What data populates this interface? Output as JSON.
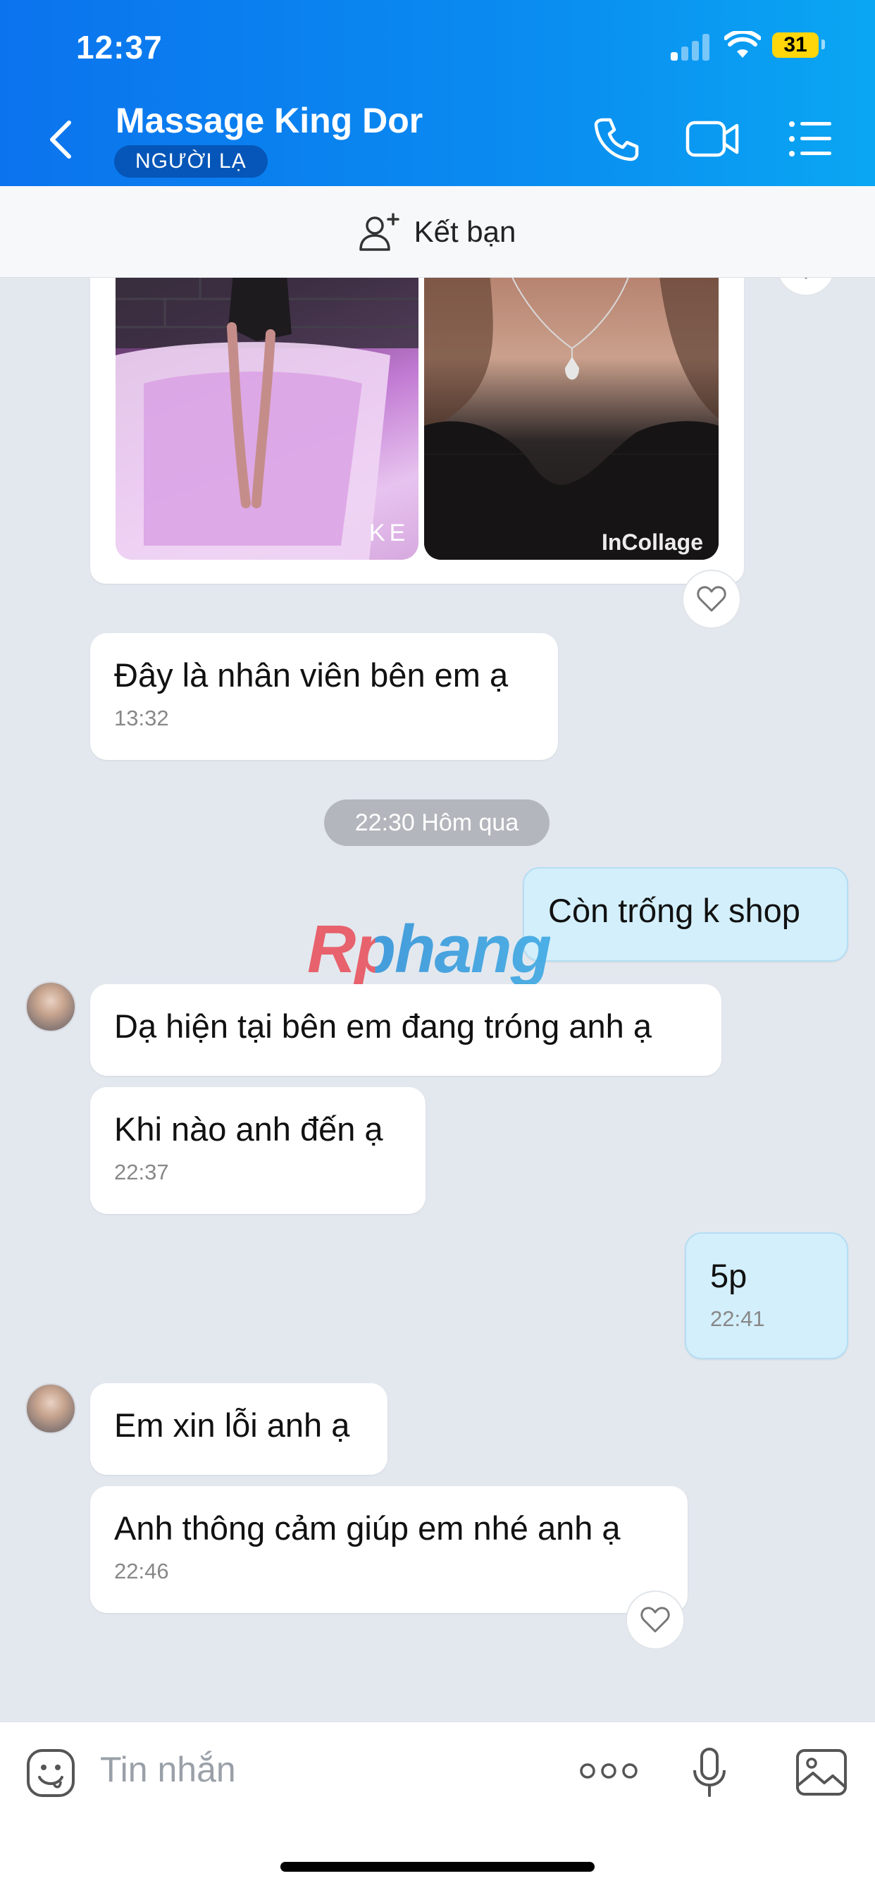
{
  "status_bar": {
    "time": "12:37",
    "battery": "31"
  },
  "header": {
    "title": "Massage King Dor",
    "badge": "NGƯỜI LẠ",
    "icons": [
      "back-icon",
      "phone-icon",
      "video-call-icon",
      "menu-list-icon"
    ]
  },
  "friend_bar": {
    "label": "Kết bạn",
    "icon": "add-friend-icon"
  },
  "photo": {
    "collage_mark": "InCollage",
    "left_mark": "KE"
  },
  "messages": [
    {
      "id": "m1",
      "direction": "in",
      "text": "Đây là nhân viên bên em ạ",
      "time": "13:32"
    },
    {
      "id": "m2",
      "direction": "out",
      "text": "Còn trống k shop",
      "time": ""
    },
    {
      "id": "m3",
      "direction": "in",
      "text": "Dạ hiện tại bên em đang tróng anh ạ",
      "time": ""
    },
    {
      "id": "m4",
      "direction": "in",
      "text": "Khi nào anh đến ạ",
      "time": "22:37"
    },
    {
      "id": "m5",
      "direction": "out",
      "text": "5p",
      "time": "22:41"
    },
    {
      "id": "m6",
      "direction": "in",
      "text": "Em xin lỗi anh ạ",
      "time": ""
    },
    {
      "id": "m7",
      "direction": "in",
      "text": "Anh thông cảm giúp em nhé anh ạ",
      "time": "22:46"
    }
  ],
  "date_separator": "22:30 Hôm qua",
  "watermark": "Rphang",
  "input": {
    "placeholder": "Tin nhắn",
    "icons": [
      "emoji-icon",
      "more-icon",
      "microphone-icon",
      "image-icon"
    ]
  },
  "colors": {
    "header_gradient_start": "#0b73ee",
    "header_gradient_end": "#0aa6f3",
    "chat_background": "#e3e8ef",
    "outgoing_bubble": "#d3effc",
    "incoming_bubble": "#ffffff"
  }
}
